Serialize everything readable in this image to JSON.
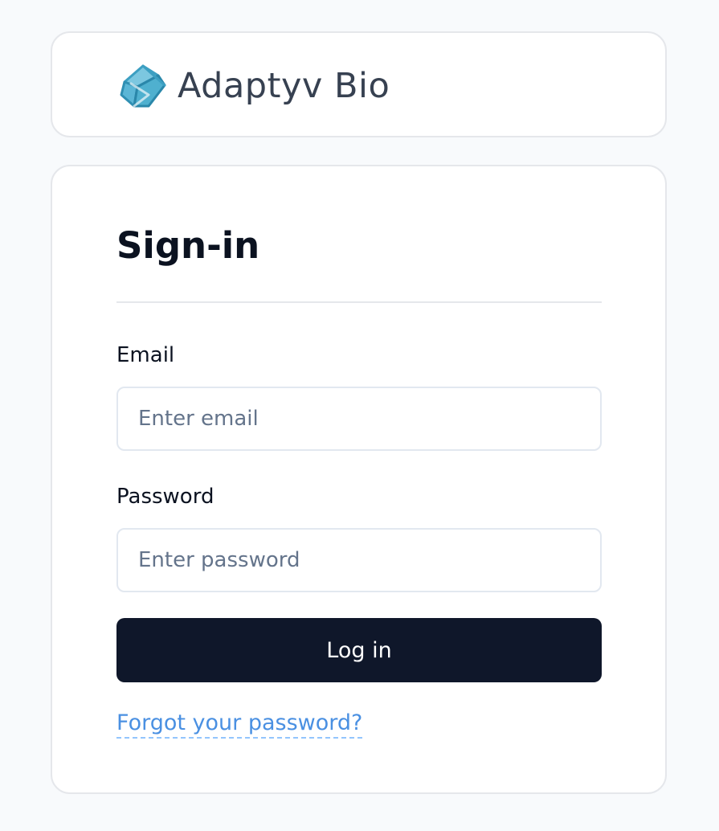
{
  "brand": {
    "name": "Adaptyv Bio",
    "logo_icon": "adaptyv-bio-logo",
    "logo_color": "#4fb0cf"
  },
  "login": {
    "title": "Sign-in",
    "email_label": "Email",
    "email_placeholder": "Enter email",
    "email_value": "",
    "password_label": "Password",
    "password_placeholder": "Enter password",
    "password_value": "",
    "submit_label": "Log in",
    "forgot_label": "Forgot your password?"
  },
  "colors": {
    "page_background": "#f8fafc",
    "card_background": "#ffffff",
    "primary_button": "#0f172a",
    "link": "#4a90e2"
  }
}
